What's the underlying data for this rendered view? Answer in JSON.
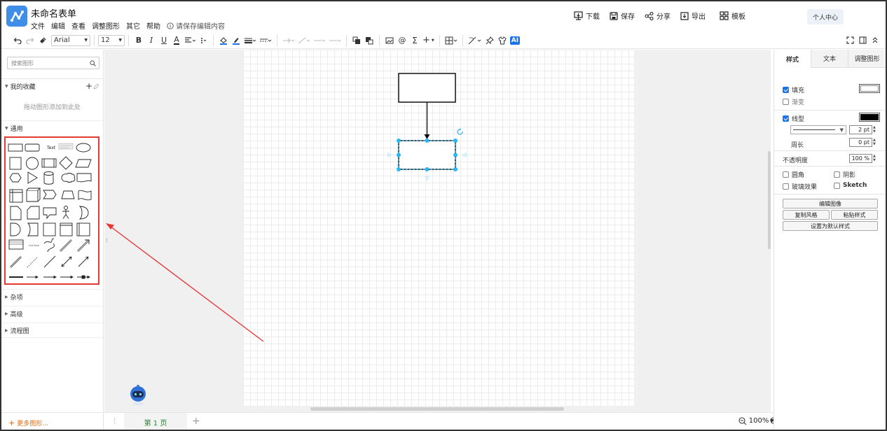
{
  "header": {
    "title": "未命名表单",
    "menus": [
      "文件",
      "编辑",
      "查看",
      "调整图形",
      "其它",
      "帮助"
    ],
    "save_hint": "请保存编辑内容",
    "actions": {
      "download": "下载",
      "save": "保存",
      "share": "分享",
      "export": "导出",
      "template": "模板"
    },
    "personal_center": "个人中心"
  },
  "toolbar": {
    "font_name": "Arial",
    "font_size": "12",
    "ai_label": "AI"
  },
  "left_panel": {
    "search_placeholder": "搜索图形",
    "favorites_label": "我的收藏",
    "favorites_hint": "拖动图形添加到此处",
    "general_label": "通用",
    "misc_label": "杂项",
    "advanced_label": "高级",
    "flowchart_label": "流程图",
    "more_shapes": "更多图形...",
    "text_shape_label": "Text",
    "list_item_label": "List Item"
  },
  "footer": {
    "page_tab": "第 1 页",
    "zoom": "100%"
  },
  "right_panel": {
    "tabs": [
      "样式",
      "文本",
      "调整图形"
    ],
    "fill_label": "填充",
    "fill_checked": true,
    "fill_color": "#ffffff",
    "gradient_label": "渐变",
    "line_label": "线型",
    "line_checked": true,
    "line_color": "#000000",
    "line_width": "2 pt",
    "perimeter_label": "周长",
    "perimeter_value": "0 pt",
    "opacity_label": "不透明度",
    "opacity_value": "100 %",
    "rounded_label": "圆角",
    "shadow_label": "阴影",
    "glass_label": "玻璃效果",
    "sketch_label": "Sketch",
    "edit_image_btn": "编辑图像",
    "copy_style_btn": "复制风格",
    "paste_style_btn": "粘贴样式",
    "set_default_btn": "设置为默认样式"
  },
  "colors": {
    "accent": "#1a73e8",
    "selection_handle": "#29b6f6",
    "annotation": "#e53935",
    "logo": "#3f8ee8"
  }
}
